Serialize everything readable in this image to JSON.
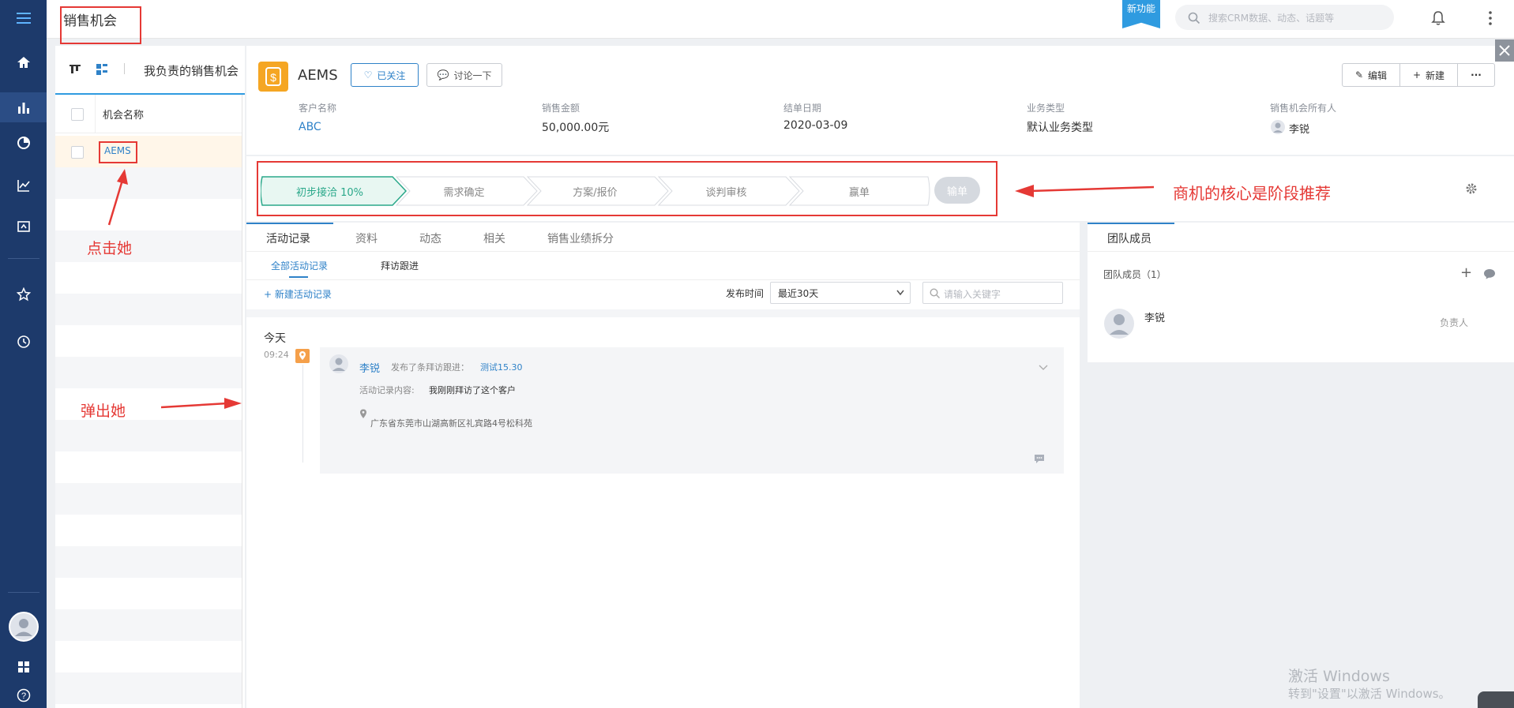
{
  "topbar": {
    "title": "销售机会",
    "new_badge": "新功能",
    "search_placeholder": "搜索CRM数据、动态、话题等"
  },
  "list": {
    "view_title": "我负责的销售机会",
    "column_header": "机会名称",
    "rows": [
      "AEMS"
    ]
  },
  "record": {
    "name": "AEMS",
    "follow_label": "已关注",
    "discuss_label": "讨论一下",
    "edit_label": "编辑",
    "new_label": "新建",
    "more_label": "···",
    "fields": [
      {
        "label": "客户名称",
        "value": "ABC"
      },
      {
        "label": "销售金额",
        "value": "50,000.00元"
      },
      {
        "label": "结单日期",
        "value": "2020-03-09"
      },
      {
        "label": "业务类型",
        "value": "默认业务类型"
      },
      {
        "label": "销售机会所有人",
        "value": "李锐"
      }
    ]
  },
  "stages": {
    "items": [
      "初步接洽 10%",
      "需求确定",
      "方案/报价",
      "谈判审核",
      "赢单"
    ],
    "lose_label": "输单",
    "active_index": 0
  },
  "annotations": {
    "click_her": "点击她",
    "popup_her": "弹出她",
    "core_stage": "商机的核心是阶段推荐"
  },
  "activity": {
    "tabs": [
      "活动记录",
      "资料",
      "动态",
      "相关",
      "销售业绩拆分"
    ],
    "subtabs": [
      "全部活动记录",
      "拜访跟进"
    ],
    "new_record": "+ 新建活动记录",
    "filter_label": "发布时间",
    "filter_value": "最近30天",
    "keyword_placeholder": "请输入关键字",
    "day_label": "今天",
    "time": "09:24",
    "author": "李锐",
    "action_text": "发布了条拜访跟进：",
    "action_link": "测试15.30",
    "content_label": "活动记录内容:",
    "content_text": "我刚刚拜访了这个客户",
    "location": "广东省东莞市山湖高新区礼宾路4号松科苑"
  },
  "team": {
    "tab_label": "团队成员",
    "section_label": "团队成员（1）",
    "member_name": "李锐",
    "member_role": "负责人"
  },
  "watermark": {
    "line1": "激活 Windows",
    "line2": "转到\"设置\"以激活 Windows。"
  },
  "colors": {
    "rail": "#1d3a6b",
    "accent": "#2f82c8",
    "stage_active": "#2aa88a",
    "annotation": "#e53935",
    "badge": "#2f9be0"
  }
}
